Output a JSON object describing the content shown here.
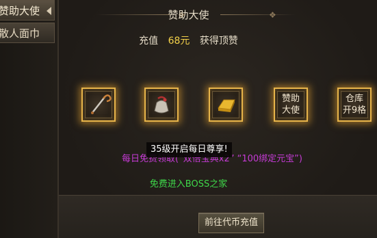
{
  "tabs": [
    {
      "label": "赞助大使"
    },
    {
      "label": "散人面巾"
    }
  ],
  "header": {
    "title": "赞助大使",
    "recharge_prefix": "充值",
    "recharge_amount": "68元",
    "recharge_suffix": "获得顶赞"
  },
  "rewards": [
    {
      "icon": "staff-icon"
    },
    {
      "icon": "bag-icon"
    },
    {
      "icon": "gold-bar-icon"
    },
    {
      "label": "赞助\n大使"
    },
    {
      "label": "仓库\n开9格"
    }
  ],
  "tooltip": "35级开启每日尊享!",
  "description": "每日免费领取(“双倍宝典x2” “100绑定元宝”)",
  "boss_text": "免费进入BOSS之家",
  "footer": {
    "button_label": "前往代币充值"
  },
  "colors": {
    "accent_gold": "#e7b44a",
    "amount_yellow": "#f5d24a",
    "desc_purple": "#c63bd6",
    "boss_green": "#3fd84a"
  }
}
